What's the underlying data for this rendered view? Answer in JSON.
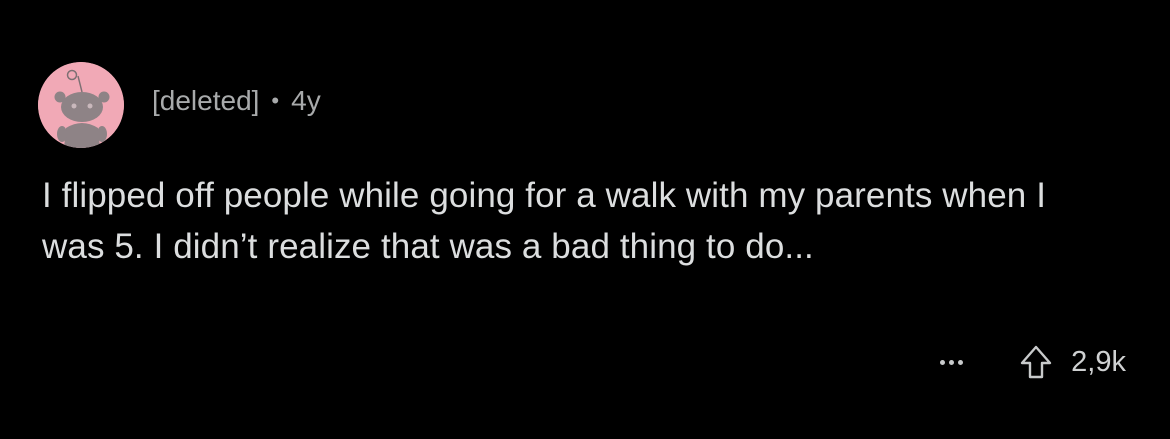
{
  "comment": {
    "author": "[deleted]",
    "separator": "•",
    "age": "4y",
    "body": "I flipped off people while going for a walk with my parents when I was 5. I didn’t realize that was a bad thing to do...",
    "score": "2,9k",
    "icons": {
      "avatar": "reddit-snoo-avatar-icon",
      "more": "more-options-icon",
      "upvote": "upvote-arrow-icon"
    }
  },
  "colors": {
    "background": "#000000",
    "avatar_bg": "#f1a9b6",
    "meta_text": "#a8aaab",
    "body_text": "#dcdedf"
  }
}
